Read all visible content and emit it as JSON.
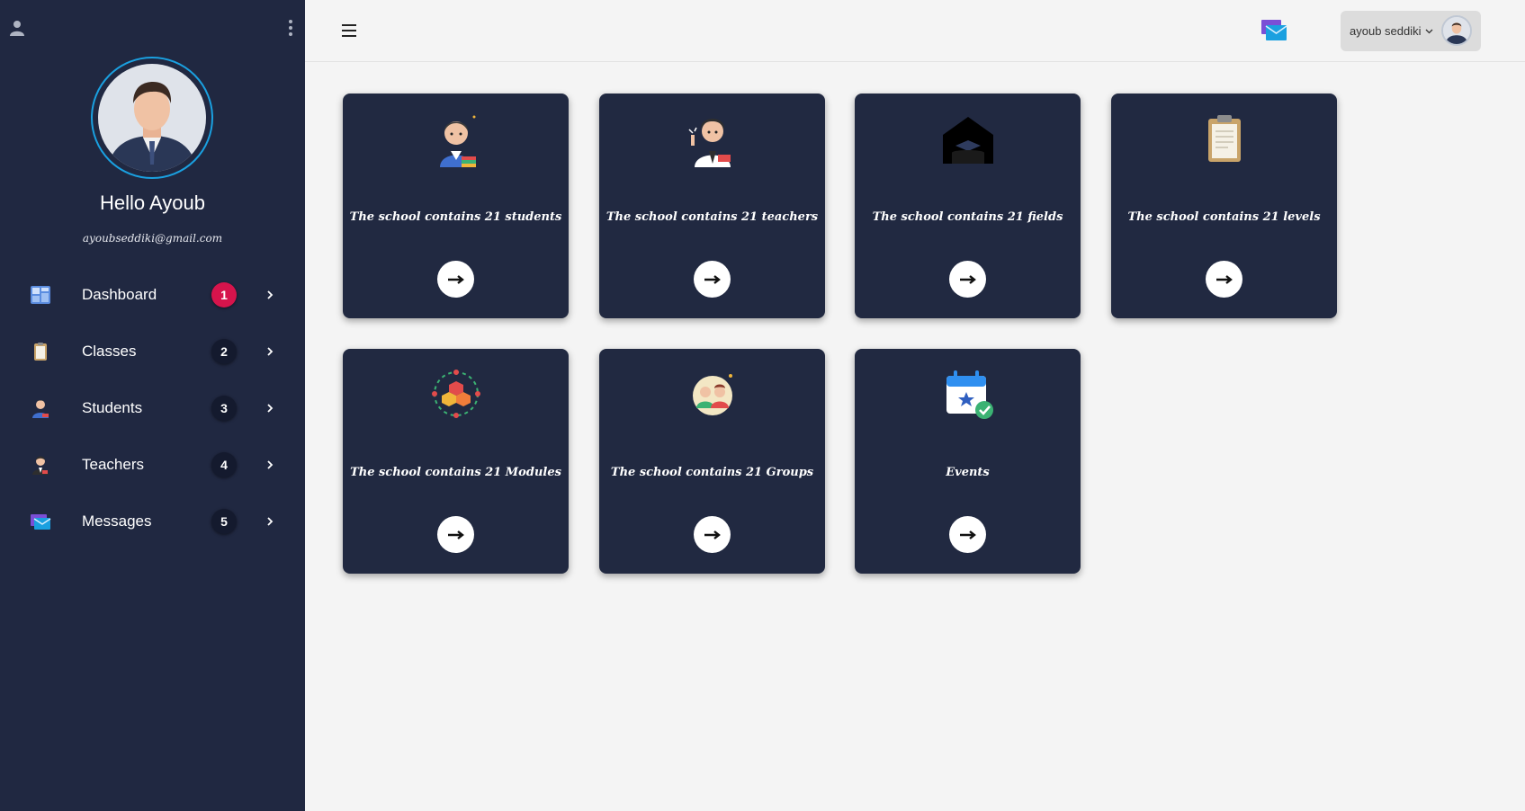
{
  "sidebar": {
    "greeting": "Hello Ayoub",
    "email": "ayoubseddiki@gmail.com",
    "items": [
      {
        "label": "Dashboard",
        "badge": "1",
        "icon": "dashboard-icon"
      },
      {
        "label": "Classes",
        "badge": "2",
        "icon": "clipboard-icon"
      },
      {
        "label": "Students",
        "badge": "3",
        "icon": "student-icon"
      },
      {
        "label": "Teachers",
        "badge": "4",
        "icon": "teacher-icon"
      },
      {
        "label": "Messages",
        "badge": "5",
        "icon": "mail-icon"
      }
    ]
  },
  "header": {
    "username": "ayoub seddiki"
  },
  "cards": [
    {
      "text": "The school contains 21 students",
      "icon": "student-icon"
    },
    {
      "text": "The school contains 21 teachers",
      "icon": "teacher-icon"
    },
    {
      "text": "The school contains 21 fields",
      "icon": "school-building-icon"
    },
    {
      "text": "The school contains 21 levels",
      "icon": "clipboard-icon"
    },
    {
      "text": "The school contains 21 Modules",
      "icon": "modules-icon"
    },
    {
      "text": "The school contains 21 Groups",
      "icon": "groups-icon"
    },
    {
      "text": "Events",
      "icon": "calendar-check-icon"
    }
  ],
  "colors": {
    "sidebar_bg": "#202841",
    "card_bg": "#212941",
    "badge_active": "#d6144c",
    "badge_bg": "#141a2e",
    "avatar_ring": "#1aa0e0",
    "page_bg": "#f4f4f4"
  }
}
